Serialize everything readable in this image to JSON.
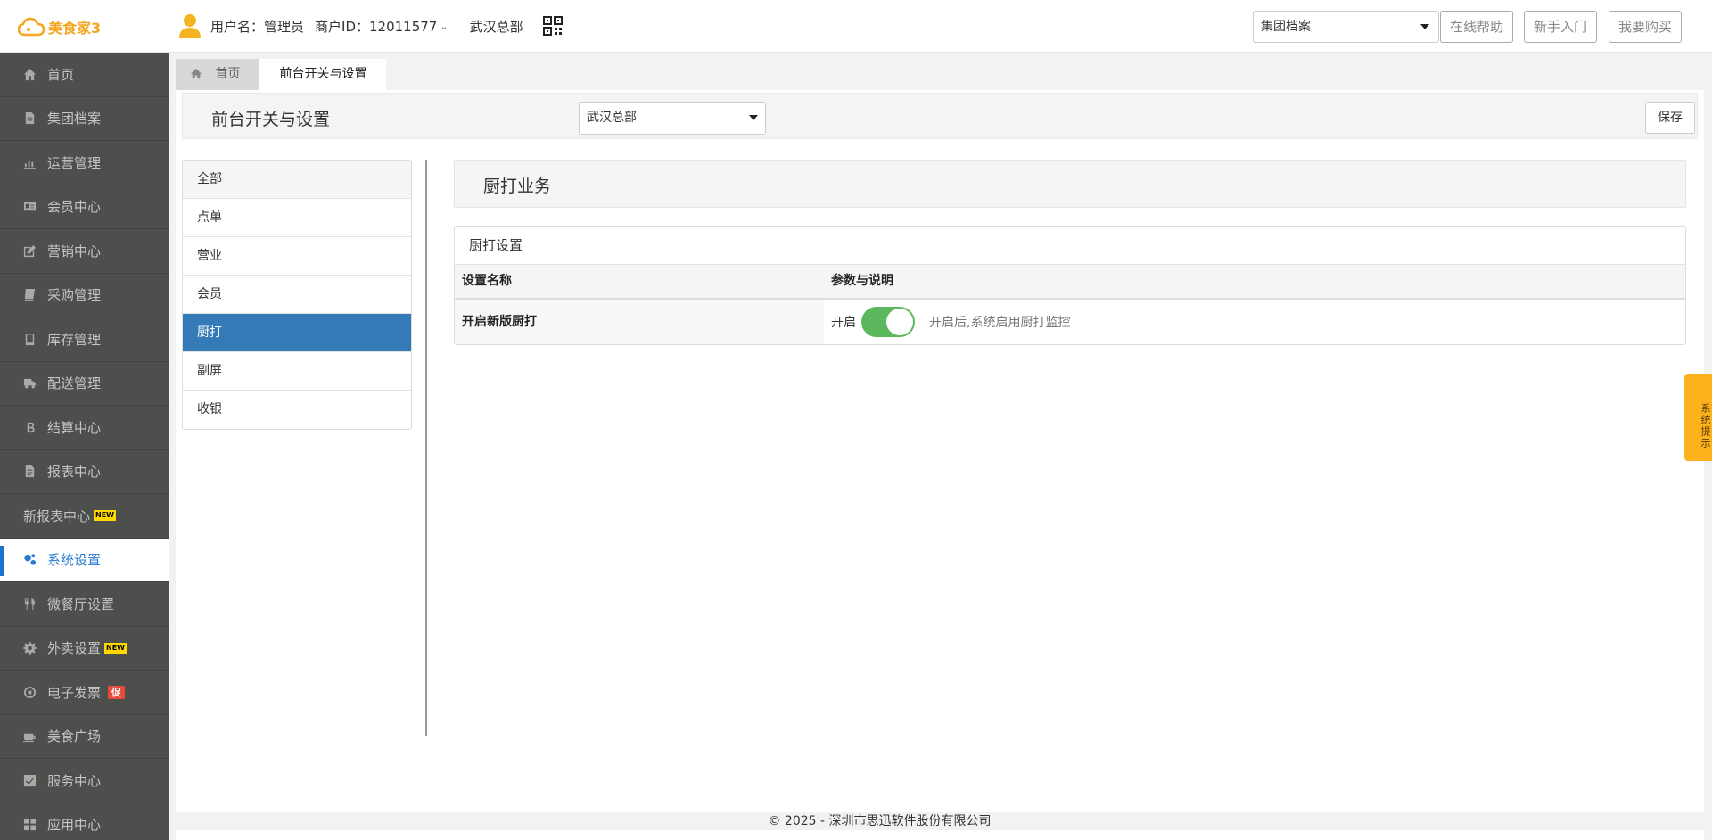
{
  "header": {
    "logo_text": "美食家3",
    "username_label": "用户名：管理员",
    "merchant_id_label": "商户ID：12011577",
    "store_name": "武汉总部",
    "top_select_value": "集团档案",
    "buttons": [
      {
        "label": "在线帮助"
      },
      {
        "label": "新手入门"
      },
      {
        "label": "我要购买"
      }
    ]
  },
  "sidebar": {
    "items": [
      {
        "label": "首页",
        "icon": "home-icon"
      },
      {
        "label": "集团档案",
        "icon": "file-icon"
      },
      {
        "label": "运营管理",
        "icon": "bar-chart-icon"
      },
      {
        "label": "会员中心",
        "icon": "id-card-icon"
      },
      {
        "label": "营销中心",
        "icon": "edit-icon"
      },
      {
        "label": "采购管理",
        "icon": "book-icon"
      },
      {
        "label": "库存管理",
        "icon": "tablet-icon"
      },
      {
        "label": "配送管理",
        "icon": "truck-icon"
      },
      {
        "label": "结算中心",
        "icon": "bitcoin-icon"
      },
      {
        "label": "报表中心",
        "icon": "report-icon"
      },
      {
        "label": "新报表中心",
        "badge": "NEW"
      },
      {
        "label": "系统设置",
        "icon": "cogs-icon",
        "active": true
      },
      {
        "label": "微餐厅设置",
        "icon": "cutlery-icon"
      },
      {
        "label": "外卖设置",
        "icon": "gear-icon",
        "badge": "NEW"
      },
      {
        "label": "电子发票",
        "icon": "circle-icon",
        "badge_cu": "促"
      },
      {
        "label": "美食广场",
        "icon": "coffee-icon"
      },
      {
        "label": "服务中心",
        "icon": "check-square-icon"
      },
      {
        "label": "应用中心",
        "icon": "apps-icon"
      }
    ]
  },
  "tabs": [
    {
      "label": "首页"
    },
    {
      "label": "前台开关与设置"
    }
  ],
  "page": {
    "title": "前台开关与设置",
    "store_select_value": "武汉总部",
    "save_label": "保存"
  },
  "categories": [
    {
      "label": "全部"
    },
    {
      "label": "点单"
    },
    {
      "label": "营业"
    },
    {
      "label": "会员"
    },
    {
      "label": "厨打",
      "active": true
    },
    {
      "label": "副屏"
    },
    {
      "label": "收银"
    }
  ],
  "section": {
    "title": "厨打业务",
    "box_title": "厨打设置",
    "columns": [
      "设置名称",
      "参数与说明"
    ],
    "rows": [
      {
        "name": "开启新版厨打",
        "state_label": "开启",
        "switch_on": true,
        "description": "开启后,系统启用厨打监控"
      }
    ]
  },
  "footer": {
    "text": "© 2025 - 深圳市思迅软件股份有限公司"
  },
  "side_tip": {
    "text": "系统提示"
  },
  "colors": {
    "sidebar_bg": "#4c4f4b",
    "active_blue": "#337ab7",
    "switch_green": "#5cb85c",
    "logo_orange": "#f5a623",
    "tip_orange": "#fbb21c"
  }
}
